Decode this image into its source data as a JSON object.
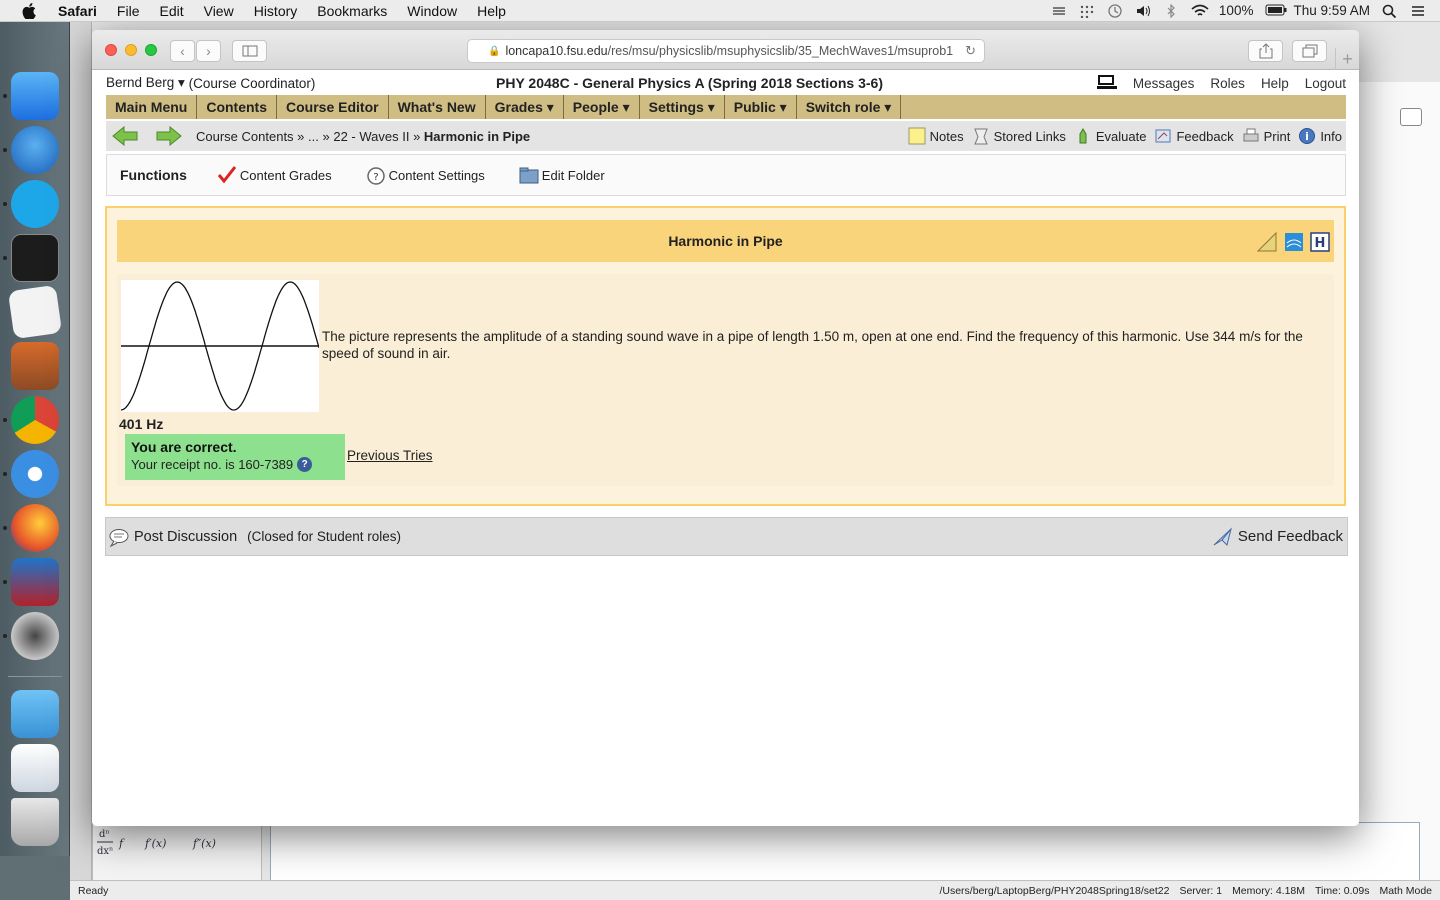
{
  "menubar": {
    "app_name": "Safari",
    "menus": [
      "File",
      "Edit",
      "View",
      "History",
      "Bookmarks",
      "Window",
      "Help"
    ],
    "battery": "100%",
    "clock": "Thu 9:59 AM"
  },
  "browser": {
    "url_host": "loncapa10.fsu.edu",
    "url_path": "/res/msu/physicslib/msuphysicslib/35_MechWaves1/msuprob1"
  },
  "header": {
    "user": "Bernd Berg ▾",
    "role": "(Course Coordinator)",
    "course_title": "PHY 2048C - General Physics A (Spring 2018 Sections 3-6)",
    "links": [
      "Messages",
      "Roles",
      "Help",
      "Logout"
    ]
  },
  "main_menu": [
    "Main Menu",
    "Contents",
    "Course Editor",
    "What's New",
    "Grades ▾",
    "People ▾",
    "Settings ▾",
    "Public ▾",
    "Switch role ▾"
  ],
  "breadcrumb": {
    "part1": "Course Contents",
    "sep1": " » ",
    "part2": "...",
    "sep2": " » ",
    "part3": "22 - Waves II",
    "sep3": " » ",
    "current": "Harmonic in Pipe"
  },
  "nav_tools": [
    "Notes",
    "Stored Links",
    "Evaluate",
    "Feedback",
    "Print",
    "Info"
  ],
  "functions": {
    "label": "Functions",
    "items": [
      "Content Grades",
      "Content Settings",
      "Edit Folder"
    ]
  },
  "problem": {
    "title": "Harmonic in Pipe",
    "text": "The picture represents the amplitude of a standing sound wave in a pipe of length 1.50 m, open at one end. Find the frequency of this harmonic. Use 344 m/s for the speed of sound in air.",
    "answer": "401 Hz",
    "correct_msg": "You are correct.",
    "receipt": "Your receipt no. is 160-7389",
    "previous_tries": "Previous Tries"
  },
  "discussion": {
    "post": "Post Discussion",
    "closed": "(Closed for Student roles)",
    "send_feedback": "Send Feedback"
  },
  "statusbar": {
    "left": "Ready",
    "path": "/Users/berg/LaptopBerg/PHY2048Spring18/set22",
    "server": "Server: 1",
    "memory": "Memory: 4.18M",
    "time": "Time: 0.09s",
    "mode": "Math Mode"
  },
  "colors": {
    "menu_bar_gold": "#cfbd83",
    "problem_border": "#fad06a",
    "problem_title_bg": "#fad47a",
    "correct_green": "#8de08d"
  }
}
